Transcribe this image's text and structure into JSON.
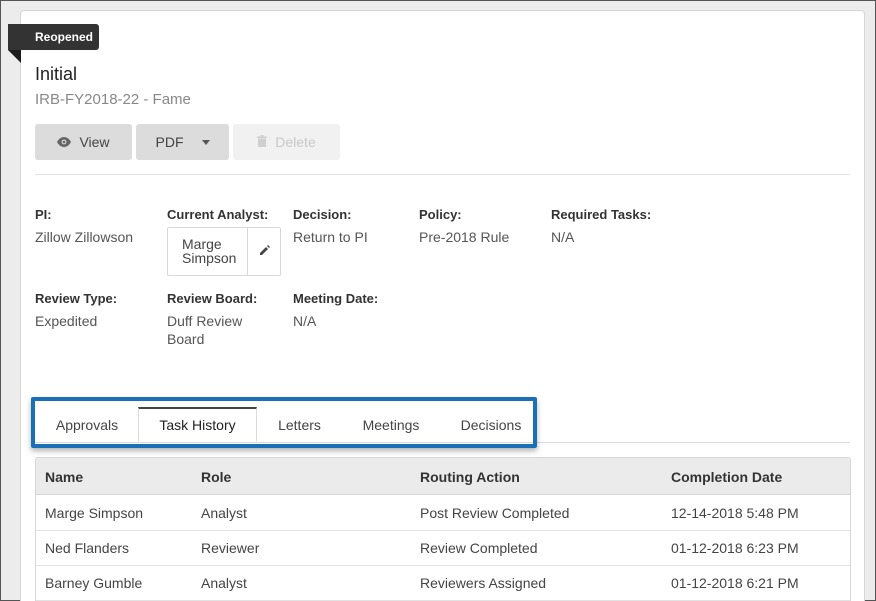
{
  "status_ribbon": "Reopened",
  "header": {
    "title": "Initial",
    "subtitle": "IRB-FY2018-22 - Fame"
  },
  "toolbar": {
    "view_label": "View",
    "pdf_label": "PDF",
    "delete_label": "Delete"
  },
  "fields": {
    "pi": {
      "label": "PI:",
      "value": "Zillow Zillowson"
    },
    "current_analyst": {
      "label": "Current Analyst:",
      "value_line1": "Marge",
      "value_line2": "Simpson"
    },
    "decision": {
      "label": "Decision:",
      "value": "Return to PI"
    },
    "policy": {
      "label": "Policy:",
      "value": "Pre-2018 Rule"
    },
    "required_tasks": {
      "label": "Required Tasks:",
      "value": "N/A"
    },
    "review_type": {
      "label": "Review Type:",
      "value": "Expedited"
    },
    "review_board": {
      "label": "Review Board:",
      "value_line1": "Duff Review",
      "value_line2": "Board"
    },
    "meeting_date": {
      "label": "Meeting Date:",
      "value": "N/A"
    }
  },
  "tabs": [
    {
      "label": "Approvals",
      "active": false
    },
    {
      "label": "Task History",
      "active": true
    },
    {
      "label": "Letters",
      "active": false
    },
    {
      "label": "Meetings",
      "active": false
    },
    {
      "label": "Decisions",
      "active": false
    }
  ],
  "table": {
    "columns": [
      "Name",
      "Role",
      "Routing Action",
      "Completion Date"
    ],
    "rows": [
      [
        "Marge Simpson",
        "Analyst",
        "Post Review Completed",
        "12-14-2018 5:48 PM"
      ],
      [
        "Ned Flanders",
        "Reviewer",
        "Review Completed",
        "01-12-2018 6:23 PM"
      ],
      [
        "Barney Gumble",
        "Analyst",
        "Reviewers Assigned",
        "01-12-2018 6:21 PM"
      ]
    ]
  },
  "colors": {
    "highlight": "#1a6fb5",
    "ribbon": "#333333"
  }
}
